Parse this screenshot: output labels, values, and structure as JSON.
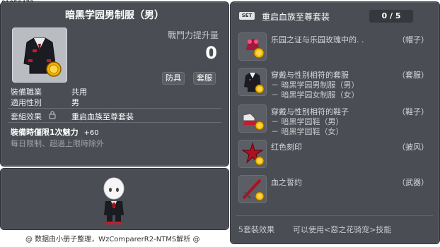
{
  "item_code": "01050473",
  "item": {
    "title": "暗黑学园男制服（男）",
    "power_label": "戰鬥力提升量",
    "power_value": "0",
    "categories": [
      "防具",
      "套服"
    ],
    "job_label": "裝備職業",
    "job_value": "共用",
    "gender_label": "適用性別",
    "gender_value": "男",
    "set_effect_label": "套組效果",
    "set_effect_value": "重启血族至尊套装",
    "limit_line": "裝備時僅限1次魅力",
    "limit_bonus": "+60",
    "daily_limit": "每日限制、超過上限時除外"
  },
  "set": {
    "badge": "SET",
    "title": "重启血族至尊套装",
    "count": "0 / 5",
    "items": [
      {
        "name": "乐园之证与乐园玫瑰中的. .",
        "category": "（帽子）",
        "subs": [],
        "icon": "hat-icon"
      },
      {
        "name": "穿戴与性别相符的套服",
        "category": "（套服）",
        "subs": [
          "－ 暗黑学园男制服（男）",
          "－ 暗黑学园女制服（女）"
        ],
        "icon": "uniform-icon"
      },
      {
        "name": "穿戴与性别相符的鞋子",
        "category": "（鞋子）",
        "subs": [
          "－ 暗黑学园鞋（男）",
          "－ 暗黑学园鞋（女）"
        ],
        "icon": "shoes-icon"
      },
      {
        "name": "红色刻印",
        "category": "（披风）",
        "subs": [],
        "icon": "cape-icon"
      },
      {
        "name": "血之誓约",
        "category": "（武器）",
        "subs": [],
        "icon": "weapon-icon"
      }
    ],
    "bottom_left": "5套裝效果",
    "bottom_right": "可以使用<惡之花骑宠>技能"
  },
  "footer": "@ 数据由小册子整理，WzComparerR2-NTMS解析 @"
}
